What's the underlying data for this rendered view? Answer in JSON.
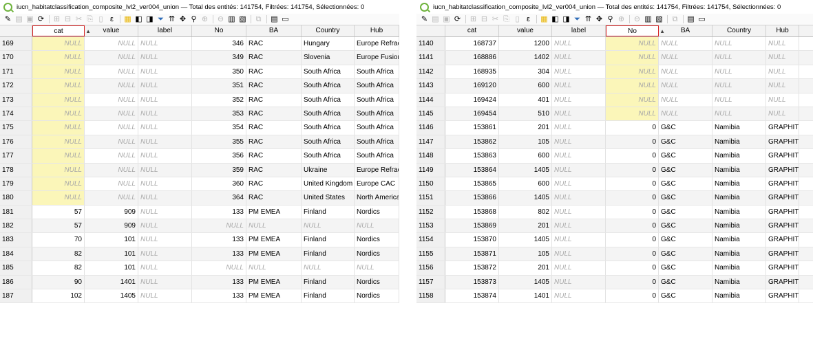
{
  "left": {
    "title": "iucn_habitatclassification_composite_lvl2_ver004_union — Total des entités: 141754, Filtrées: 141754, Sélectionnées: 0",
    "headers": [
      "",
      "cat",
      "value",
      "label",
      "No",
      "BA",
      "Country",
      "Hub"
    ],
    "sorted_column": "cat",
    "rows": [
      {
        "n": "169",
        "cat": "NULL",
        "value": "NULL",
        "label": "NULL",
        "No": "346",
        "BA": "RAC",
        "Country": "Hungary",
        "Hub": "Europe Refract..."
      },
      {
        "n": "170",
        "cat": "NULL",
        "value": "NULL",
        "label": "NULL",
        "No": "349",
        "BA": "RAC",
        "Country": "Slovenia",
        "Hub": "Europe Fusion"
      },
      {
        "n": "171",
        "cat": "NULL",
        "value": "NULL",
        "label": "NULL",
        "No": "350",
        "BA": "RAC",
        "Country": "South Africa",
        "Hub": "South Africa"
      },
      {
        "n": "172",
        "cat": "NULL",
        "value": "NULL",
        "label": "NULL",
        "No": "351",
        "BA": "RAC",
        "Country": "South Africa",
        "Hub": "South Africa"
      },
      {
        "n": "173",
        "cat": "NULL",
        "value": "NULL",
        "label": "NULL",
        "No": "352",
        "BA": "RAC",
        "Country": "South Africa",
        "Hub": "South Africa"
      },
      {
        "n": "174",
        "cat": "NULL",
        "value": "NULL",
        "label": "NULL",
        "No": "353",
        "BA": "RAC",
        "Country": "South Africa",
        "Hub": "South Africa"
      },
      {
        "n": "175",
        "cat": "NULL",
        "value": "NULL",
        "label": "NULL",
        "No": "354",
        "BA": "RAC",
        "Country": "South Africa",
        "Hub": "South Africa"
      },
      {
        "n": "176",
        "cat": "NULL",
        "value": "NULL",
        "label": "NULL",
        "No": "355",
        "BA": "RAC",
        "Country": "South Africa",
        "Hub": "South Africa"
      },
      {
        "n": "177",
        "cat": "NULL",
        "value": "NULL",
        "label": "NULL",
        "No": "356",
        "BA": "RAC",
        "Country": "South Africa",
        "Hub": "South Africa"
      },
      {
        "n": "178",
        "cat": "NULL",
        "value": "NULL",
        "label": "NULL",
        "No": "359",
        "BA": "RAC",
        "Country": "Ukraine",
        "Hub": "Europe Refract..."
      },
      {
        "n": "179",
        "cat": "NULL",
        "value": "NULL",
        "label": "NULL",
        "No": "360",
        "BA": "RAC",
        "Country": "United Kingdom",
        "Hub": "Europe CAC"
      },
      {
        "n": "180",
        "cat": "NULL",
        "value": "NULL",
        "label": "NULL",
        "No": "364",
        "BA": "RAC",
        "Country": "United States",
        "Hub": "North America"
      },
      {
        "n": "181",
        "cat": "57",
        "value": "909",
        "label": "NULL",
        "No": "133",
        "BA": "PM EMEA",
        "Country": "Finland",
        "Hub": "Nordics"
      },
      {
        "n": "182",
        "cat": "57",
        "value": "909",
        "label": "NULL",
        "No": "NULL",
        "BA": "NULL",
        "Country": "NULL",
        "Hub": "NULL"
      },
      {
        "n": "183",
        "cat": "70",
        "value": "101",
        "label": "NULL",
        "No": "133",
        "BA": "PM EMEA",
        "Country": "Finland",
        "Hub": "Nordics"
      },
      {
        "n": "184",
        "cat": "82",
        "value": "101",
        "label": "NULL",
        "No": "133",
        "BA": "PM EMEA",
        "Country": "Finland",
        "Hub": "Nordics"
      },
      {
        "n": "185",
        "cat": "82",
        "value": "101",
        "label": "NULL",
        "No": "NULL",
        "BA": "NULL",
        "Country": "NULL",
        "Hub": "NULL"
      },
      {
        "n": "186",
        "cat": "90",
        "value": "1401",
        "label": "NULL",
        "No": "133",
        "BA": "PM EMEA",
        "Country": "Finland",
        "Hub": "Nordics"
      },
      {
        "n": "187",
        "cat": "102",
        "value": "1405",
        "label": "NULL",
        "No": "133",
        "BA": "PM EMEA",
        "Country": "Finland",
        "Hub": "Nordics"
      }
    ]
  },
  "right": {
    "title": "iucn_habitatclassification_composite_lvl2_ver004_union — Total des entités: 141754, Filtrées: 141754, Sélectionnées: 0",
    "headers": [
      "",
      "cat",
      "value",
      "label",
      "No",
      "BA",
      "Country",
      "Hub"
    ],
    "sorted_column": "No",
    "rows": [
      {
        "n": "1140",
        "cat": "168737",
        "value": "1200",
        "label": "NULL",
        "No": "NULL",
        "BA": "NULL",
        "Country": "NULL",
        "Hub": "NULL"
      },
      {
        "n": "1141",
        "cat": "168886",
        "value": "1402",
        "label": "NULL",
        "No": "NULL",
        "BA": "NULL",
        "Country": "NULL",
        "Hub": "NULL"
      },
      {
        "n": "1142",
        "cat": "168935",
        "value": "304",
        "label": "NULL",
        "No": "NULL",
        "BA": "NULL",
        "Country": "NULL",
        "Hub": "NULL"
      },
      {
        "n": "1143",
        "cat": "169120",
        "value": "600",
        "label": "NULL",
        "No": "NULL",
        "BA": "NULL",
        "Country": "NULL",
        "Hub": "NULL"
      },
      {
        "n": "1144",
        "cat": "169424",
        "value": "401",
        "label": "NULL",
        "No": "NULL",
        "BA": "NULL",
        "Country": "NULL",
        "Hub": "NULL"
      },
      {
        "n": "1145",
        "cat": "169454",
        "value": "510",
        "label": "NULL",
        "No": "NULL",
        "BA": "NULL",
        "Country": "NULL",
        "Hub": "NULL"
      },
      {
        "n": "1146",
        "cat": "153861",
        "value": "201",
        "label": "NULL",
        "No": "0",
        "BA": "G&C",
        "Country": "Namibia",
        "Hub": "GRAPHITE & C..."
      },
      {
        "n": "1147",
        "cat": "153862",
        "value": "105",
        "label": "NULL",
        "No": "0",
        "BA": "G&C",
        "Country": "Namibia",
        "Hub": "GRAPHITE & C..."
      },
      {
        "n": "1148",
        "cat": "153863",
        "value": "600",
        "label": "NULL",
        "No": "0",
        "BA": "G&C",
        "Country": "Namibia",
        "Hub": "GRAPHITE & C..."
      },
      {
        "n": "1149",
        "cat": "153864",
        "value": "1405",
        "label": "NULL",
        "No": "0",
        "BA": "G&C",
        "Country": "Namibia",
        "Hub": "GRAPHITE & C..."
      },
      {
        "n": "1150",
        "cat": "153865",
        "value": "600",
        "label": "NULL",
        "No": "0",
        "BA": "G&C",
        "Country": "Namibia",
        "Hub": "GRAPHITE & C..."
      },
      {
        "n": "1151",
        "cat": "153866",
        "value": "1405",
        "label": "NULL",
        "No": "0",
        "BA": "G&C",
        "Country": "Namibia",
        "Hub": "GRAPHITE & C..."
      },
      {
        "n": "1152",
        "cat": "153868",
        "value": "802",
        "label": "NULL",
        "No": "0",
        "BA": "G&C",
        "Country": "Namibia",
        "Hub": "GRAPHITE & C..."
      },
      {
        "n": "1153",
        "cat": "153869",
        "value": "201",
        "label": "NULL",
        "No": "0",
        "BA": "G&C",
        "Country": "Namibia",
        "Hub": "GRAPHITE & C..."
      },
      {
        "n": "1154",
        "cat": "153870",
        "value": "1405",
        "label": "NULL",
        "No": "0",
        "BA": "G&C",
        "Country": "Namibia",
        "Hub": "GRAPHITE & C..."
      },
      {
        "n": "1155",
        "cat": "153871",
        "value": "105",
        "label": "NULL",
        "No": "0",
        "BA": "G&C",
        "Country": "Namibia",
        "Hub": "GRAPHITE & C..."
      },
      {
        "n": "1156",
        "cat": "153872",
        "value": "201",
        "label": "NULL",
        "No": "0",
        "BA": "G&C",
        "Country": "Namibia",
        "Hub": "GRAPHITE & C..."
      },
      {
        "n": "1157",
        "cat": "153873",
        "value": "1405",
        "label": "NULL",
        "No": "0",
        "BA": "G&C",
        "Country": "Namibia",
        "Hub": "GRAPHITE & C..."
      },
      {
        "n": "1158",
        "cat": "153874",
        "value": "1401",
        "label": "NULL",
        "No": "0",
        "BA": "G&C",
        "Country": "Namibia",
        "Hub": "GRAPHITE & C..."
      }
    ]
  },
  "toolbar_icons": [
    "pencil-icon",
    "multi-edit-icon",
    "save-icon",
    "reload-icon",
    "add-feature-icon",
    "delete-feature-icon",
    "cut-icon",
    "copy-icon",
    "paste-icon",
    "expression-select-icon",
    "select-all-icon",
    "invert-selection-icon",
    "deselect-icon",
    "filter-icon",
    "move-selection-top-icon",
    "pan-to-icon",
    "zoom-to-icon",
    "new-field-icon",
    "delete-field-icon",
    "field-calculator-icon",
    "conditional-format-icon",
    "dock-icon",
    "table-view-icon",
    "form-view-icon"
  ],
  "colors": {
    "highlight": "#fbf6b9",
    "sorted_border": "#d62020",
    "null_text": "#a8a8a8",
    "qgis_green": "#6fb33d"
  }
}
